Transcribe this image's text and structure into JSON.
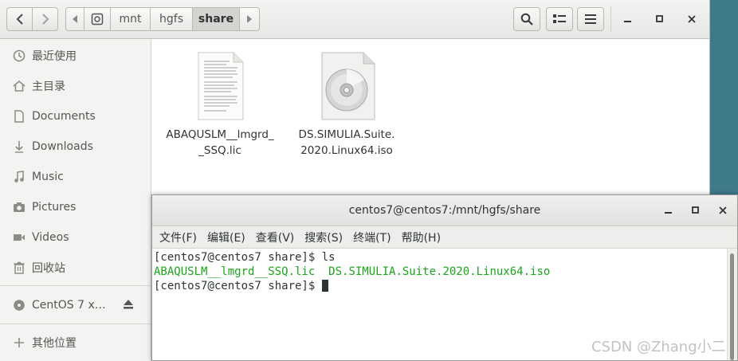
{
  "header": {
    "path": [
      "mnt",
      "hgfs",
      "share"
    ]
  },
  "sidebar": {
    "items": [
      {
        "label": "最近使用",
        "icon": "clock-icon"
      },
      {
        "label": "主目录",
        "icon": "home-icon"
      },
      {
        "label": "Documents",
        "icon": "document-icon"
      },
      {
        "label": "Downloads",
        "icon": "download-icon"
      },
      {
        "label": "Music",
        "icon": "music-icon"
      },
      {
        "label": "Pictures",
        "icon": "camera-icon"
      },
      {
        "label": "Videos",
        "icon": "video-icon"
      },
      {
        "label": "回收站",
        "icon": "trash-icon"
      }
    ],
    "devices": [
      {
        "label": "CentOS 7 x…",
        "icon": "disc-icon"
      }
    ],
    "other": {
      "label": "其他位置",
      "icon": "plus-icon"
    }
  },
  "files": [
    {
      "name_line1": "ABAQUSLM__lmgrd_",
      "name_line2": "_SSQ.lic",
      "icon": "text-file-icon"
    },
    {
      "name_line1": "DS.SIMULIA.Suite.",
      "name_line2": "2020.Linux64.iso",
      "icon": "disc-image-icon"
    }
  ],
  "terminal": {
    "title": "centos7@centos7:/mnt/hgfs/share",
    "menu": [
      "文件(F)",
      "编辑(E)",
      "查看(V)",
      "搜索(S)",
      "终端(T)",
      "帮助(H)"
    ],
    "lines": {
      "line1": "[centos7@centos7 share]$ ls",
      "line2_file1": "ABAQUSLM__lmgrd__SSQ.lic",
      "line2_file2": "DS.SIMULIA.Suite.2020.Linux64.iso",
      "line3": "[centos7@centos7 share]$ "
    }
  },
  "watermark": "CSDN @Zhang小二"
}
